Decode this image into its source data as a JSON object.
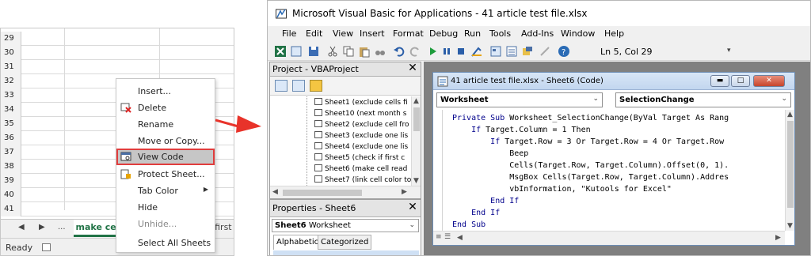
{
  "excel": {
    "rows": [
      "29",
      "30",
      "31",
      "32",
      "33",
      "34",
      "35",
      "36",
      "37",
      "38",
      "39",
      "40",
      "41"
    ],
    "sheet_tab_active": "make cell read only",
    "sheet_tab_next": "check if first",
    "nav_dots": "...",
    "status": "Ready",
    "context_menu": {
      "insert": "Insert...",
      "delete": "Delete",
      "rename": "Rename",
      "move_copy": "Move or Copy...",
      "view_code": "View Code",
      "protect": "Protect Sheet...",
      "tab_color": "Tab Color",
      "hide": "Hide",
      "unhide": "Unhide...",
      "select_all": "Select All Sheets"
    }
  },
  "vba": {
    "title": "Microsoft Visual Basic for Applications - 41 article test file.xlsx",
    "menu": [
      "File",
      "Edit",
      "View",
      "Insert",
      "Format",
      "Debug",
      "Run",
      "Tools",
      "Add-Ins",
      "Window",
      "Help"
    ],
    "cursor_position": "Ln 5, Col 29",
    "project_panel": {
      "title": "Project - VBAProject",
      "items": [
        "Sheet1 (exclude cells fi",
        "Sheet10 (next month s",
        "Sheet2 (exclude cell fro",
        "Sheet3 (exclude one lis",
        "Sheet4 (exclude one lis",
        "Sheet5 (check if first c",
        "Sheet6 (make cell read",
        "Sheet7 (link cell color to"
      ]
    },
    "properties_panel": {
      "title": "Properties - Sheet6",
      "object_bold": "Sheet6",
      "object_type": "Worksheet",
      "tabs": [
        "Alphabetic",
        "Categorized"
      ]
    },
    "code_window": {
      "title": "41 article test file.xlsx - Sheet6 (Code)",
      "object_combo": "Worksheet",
      "procedure_combo": "SelectionChange",
      "lines": [
        {
          "indent": "",
          "kw": "Private Sub ",
          "text": "Worksheet_SelectionChange(ByVal Target As Rang"
        },
        {
          "indent": "    ",
          "kw": "If ",
          "text": "Target.Column = 1 Then"
        },
        {
          "indent": "        ",
          "kw": "If ",
          "text": "Target.Row = 3 Or Target.Row = 4 Or Target.Row"
        },
        {
          "indent": "            ",
          "kw": "",
          "text": "Beep"
        },
        {
          "indent": "            ",
          "kw": "",
          "text": "Cells(Target.Row, Target.Column).Offset(0, 1)."
        },
        {
          "indent": "            ",
          "kw": "",
          "text": "MsgBox Cells(Target.Row, Target.Column).Addres"
        },
        {
          "indent": "            ",
          "kw": "",
          "text": "vbInformation, \"Kutools for Excel\""
        },
        {
          "indent": "        ",
          "kw": "End If",
          "text": ""
        },
        {
          "indent": "    ",
          "kw": "End If",
          "text": ""
        },
        {
          "indent": "",
          "kw": "End Sub",
          "text": ""
        }
      ]
    }
  }
}
